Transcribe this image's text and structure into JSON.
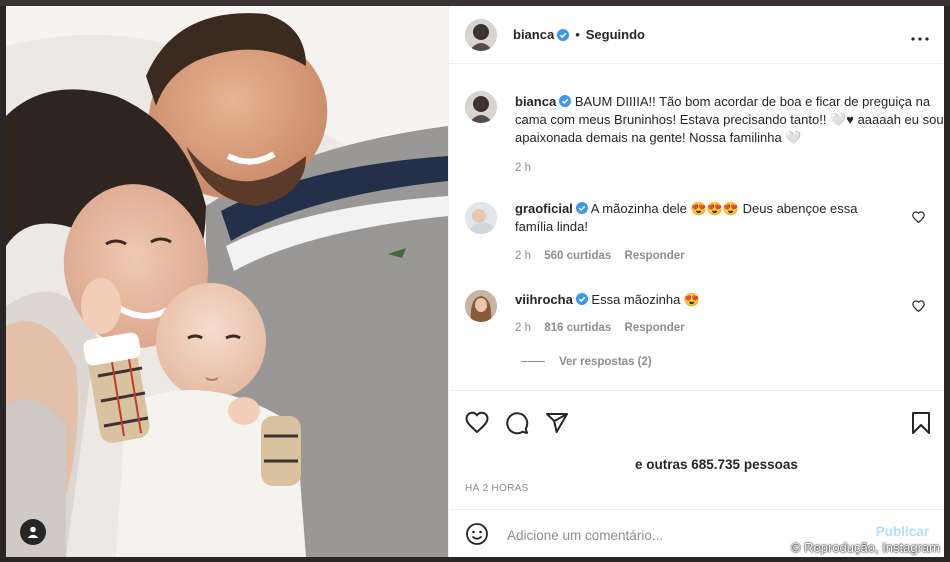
{
  "post": {
    "username": "bianca",
    "follow_status": "Seguindo",
    "caption_user": "bianca",
    "caption_text": "BAUM DIIIIA!! Tão bom acordar de boa e ficar de preguiça na cama com meus Bruninhos! Estava precisando tanto!! 🤍♥ aaaaah eu sou apaixonada demais na gente! Nossa familinha 🤍",
    "caption_time": "2 h"
  },
  "comments": [
    {
      "user": "graoficial",
      "text": "A mãozinha dele 😍😍😍 Deus abençoe essa família linda!",
      "time": "2 h",
      "likes": "560 curtidas",
      "reply": "Responder"
    },
    {
      "user": "viihrocha",
      "text": "Essa mãozinha 😍",
      "time": "2 h",
      "likes": "816 curtidas",
      "reply": "Responder",
      "view_replies": "Ver respostas (2)"
    }
  ],
  "likes_summary": "e outras 685.735 pessoas",
  "posted_ago": "HÁ 2 HORAS",
  "add_comment": {
    "placeholder": "Adicione um comentário...",
    "publish_label": "Publicar"
  },
  "credit": "© Reprodução, Instagram",
  "icons": {
    "like": "heart-icon",
    "comment": "comment-icon",
    "share": "paper-plane-icon",
    "save": "bookmark-icon",
    "options": "more-options-icon",
    "emoji": "smiley-icon",
    "verified": "verified-badge-icon",
    "user_tag": "user-tag-icon"
  },
  "colors": {
    "verified": "#3897f0",
    "publish_disabled": "#b2dffc",
    "secondary_text": "#8e8e8e"
  }
}
